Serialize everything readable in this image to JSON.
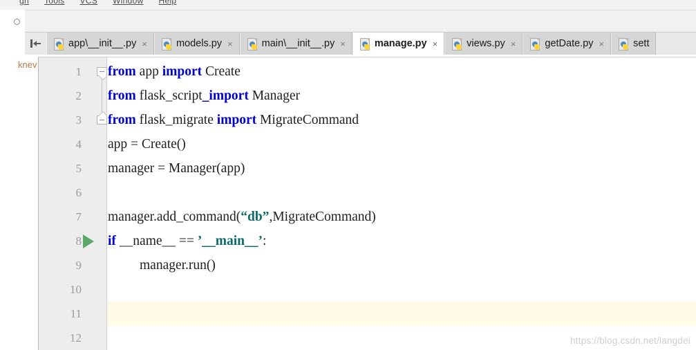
{
  "menubar": {
    "items": [
      {
        "label": "gh"
      },
      {
        "label": "Tools"
      },
      {
        "label": "VCS"
      },
      {
        "label": "Window"
      },
      {
        "label": "Help"
      }
    ]
  },
  "sidebar": {
    "collapsed_label": "knev",
    "hide_icon": "hide-sidebar-icon"
  },
  "tabs": {
    "items": [
      {
        "label": "app\\__init__.py",
        "close": "×",
        "active": false,
        "icon": "python-file-icon"
      },
      {
        "label": "models.py",
        "close": "×",
        "active": false,
        "icon": "python-file-icon"
      },
      {
        "label": "main\\__init__.py",
        "close": "×",
        "active": false,
        "icon": "python-file-icon"
      },
      {
        "label": "manage.py",
        "close": "×",
        "active": true,
        "icon": "python-file-icon"
      },
      {
        "label": "views.py",
        "close": "×",
        "active": false,
        "icon": "python-file-icon"
      },
      {
        "label": "getDate.py",
        "close": "×",
        "active": false,
        "icon": "python-file-icon"
      },
      {
        "label": "sett",
        "close": "",
        "active": false,
        "icon": "python-file-icon"
      }
    ]
  },
  "editor": {
    "current_line": 11,
    "run_marker_line": 8,
    "line_numbers": [
      "1",
      "2",
      "3",
      "4",
      "5",
      "6",
      "7",
      "8",
      "9",
      "10",
      "11",
      "12"
    ],
    "lines": [
      {
        "n": 1,
        "indent": 0,
        "tokens": [
          {
            "t": "from",
            "c": "kw"
          },
          {
            "t": " app ",
            "c": "plain"
          },
          {
            "t": "import",
            "c": "kw"
          },
          {
            "t": " Create",
            "c": "plain"
          }
        ]
      },
      {
        "n": 2,
        "indent": 0,
        "tokens": [
          {
            "t": "from",
            "c": "kw"
          },
          {
            "t": " flask_script",
            "c": "plain"
          },
          {
            "t": "_import",
            "c": "kw"
          },
          {
            "t": " Manager",
            "c": "plain"
          }
        ]
      },
      {
        "n": 3,
        "indent": 0,
        "tokens": [
          {
            "t": "from",
            "c": "kw"
          },
          {
            "t": " flask_migrate ",
            "c": "plain"
          },
          {
            "t": "import",
            "c": "kw"
          },
          {
            "t": " MigrateCommand",
            "c": "plain"
          }
        ]
      },
      {
        "n": 4,
        "indent": 0,
        "tokens": [
          {
            "t": "app = Create()",
            "c": "plain"
          }
        ]
      },
      {
        "n": 5,
        "indent": 0,
        "tokens": [
          {
            "t": "manager = Manager(app)",
            "c": "plain"
          }
        ]
      },
      {
        "n": 6,
        "indent": 0,
        "tokens": []
      },
      {
        "n": 7,
        "indent": 0,
        "tokens": [
          {
            "t": "manager.add_command(",
            "c": "plain"
          },
          {
            "t": "“db”",
            "c": "strb"
          },
          {
            "t": ",MigrateCommand)",
            "c": "plain"
          }
        ]
      },
      {
        "n": 8,
        "indent": 0,
        "tokens": [
          {
            "t": "if",
            "c": "kw"
          },
          {
            "t": " __name__ == ",
            "c": "plain"
          },
          {
            "t": "’__main__’",
            "c": "strb"
          },
          {
            "t": ":",
            "c": "plain"
          }
        ]
      },
      {
        "n": 9,
        "indent": 1,
        "tokens": [
          {
            "t": "manager.run()",
            "c": "plain"
          }
        ]
      },
      {
        "n": 10,
        "indent": 0,
        "tokens": []
      },
      {
        "n": 11,
        "indent": 0,
        "tokens": []
      },
      {
        "n": 12,
        "indent": 0,
        "tokens": []
      }
    ],
    "fold_markers": [
      {
        "line": 1,
        "kind": "down"
      },
      {
        "line": 3,
        "kind": "up"
      }
    ]
  },
  "watermark": {
    "text": "https://blog.csdn.net/langdei"
  },
  "colors": {
    "keyword": "#0000d0",
    "string": "#0b6b6b",
    "run_green": "#59a869",
    "gutter_bg": "#ededed",
    "current_line_bg": "#fffbe6",
    "tab_active_bg": "#ffffff",
    "tab_inactive_bg": "#d6d6d6"
  }
}
